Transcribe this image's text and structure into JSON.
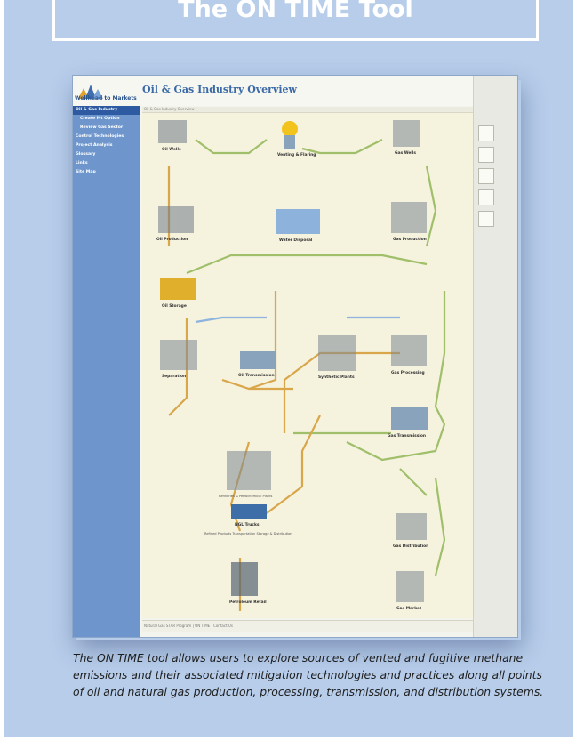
{
  "title": "The ON TIME Tool",
  "caption": "The ON TIME tool allows users to explore sources of vented and fugitive methane emissions and their associated mitigation technologies and practices along all points of oil and natural gas production, processing, transmission, and distribution systems.",
  "app": {
    "logo_text": "Wellhead to Markets",
    "page_heading": "Oil & Gas Industry Overview",
    "breadcrumb": "Oil & Gas Industry Overview",
    "footer_text": "Natural Gas STAR Program | ON TIME | Contact Us"
  },
  "sidebar": {
    "items": [
      {
        "label": "Oil & Gas Industry",
        "active": true
      },
      {
        "label": "Create Mt Option",
        "sub": true
      },
      {
        "label": "Review Gas Sector",
        "sub": true
      },
      {
        "label": "Control Technologies"
      },
      {
        "label": "Project Analysis"
      },
      {
        "label": "Glossary"
      },
      {
        "label": "Links"
      },
      {
        "label": "Site Map"
      }
    ]
  },
  "diagram_nodes": {
    "oil_wells": "Oil Wells",
    "venting_flaring": "Venting & Flaring",
    "gas_wells": "Gas Wells",
    "oil_production": "Oil Production",
    "water_disposal": "Water Disposal",
    "gas_production": "Gas Production",
    "oil_storage": "Oil Storage",
    "separation": "Separation",
    "oil_transmission": "Oil Transmission",
    "synthetic_plants": "Synthetic Plants",
    "gas_processing": "Gas Processing",
    "gas_transmission": "Gas Transmission",
    "refineries": "Refineries & Petrochemical Plants",
    "ngl_trucks": "NGL Trucks",
    "refined_products": "Refined Products Transportation Storage & Distribution",
    "gas_distribution": "Gas Distribution",
    "petroleum_retail": "Petroleum Retail",
    "gas_market": "Gas Market"
  }
}
